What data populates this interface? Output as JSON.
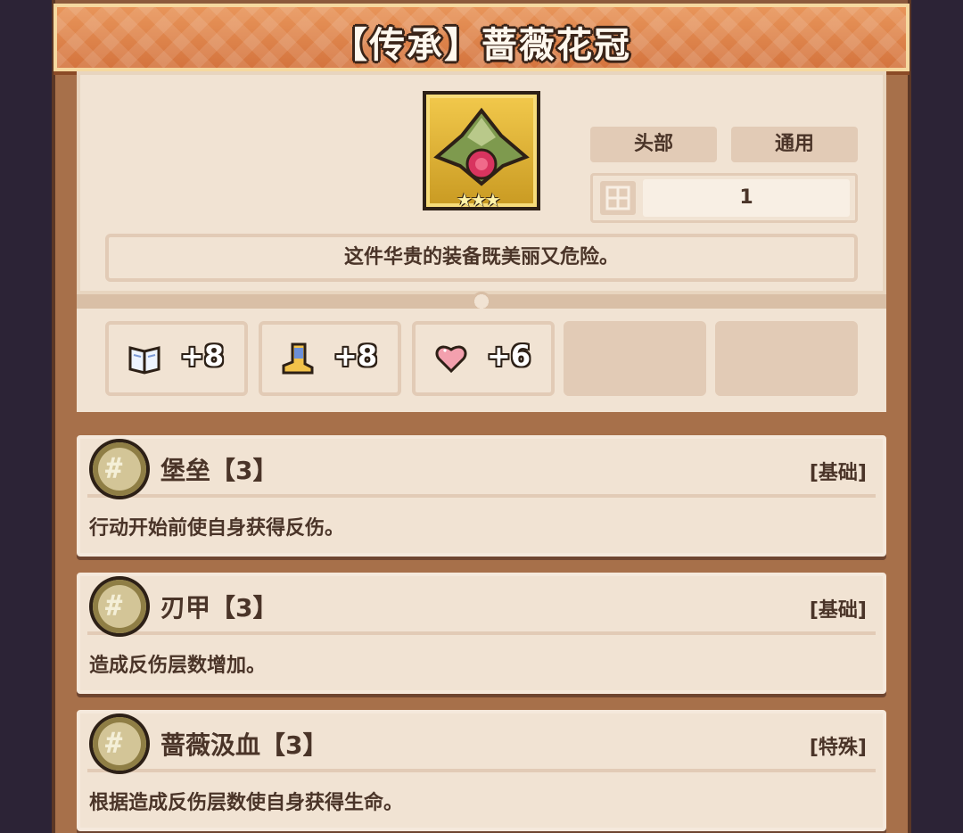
{
  "title": "【传承】蔷薇花冠",
  "item": {
    "icon": "rose-crown-icon",
    "stars": 3,
    "slot": "头部",
    "class": "通用",
    "level": "1",
    "description": "这件华贵的装备既美丽又危险。"
  },
  "stats": [
    {
      "icon": "book-icon",
      "value": "+8"
    },
    {
      "icon": "boot-icon",
      "value": "+8"
    },
    {
      "icon": "heart-icon",
      "value": "+6"
    }
  ],
  "skills": [
    {
      "name": "堡垒【3】",
      "type": "[基础]",
      "description": "行动开始前使自身获得反伤。"
    },
    {
      "name": "刃甲【3】",
      "type": "[基础]",
      "description": "造成反伤层数增加。"
    },
    {
      "name": "蔷薇汲血【3】",
      "type": "[特殊]",
      "description": "根据造成反伤层数使自身获得生命。"
    }
  ],
  "colors": {
    "panel": "#f1e3d3",
    "banner": "#e08a50",
    "text": "#4a3428"
  }
}
